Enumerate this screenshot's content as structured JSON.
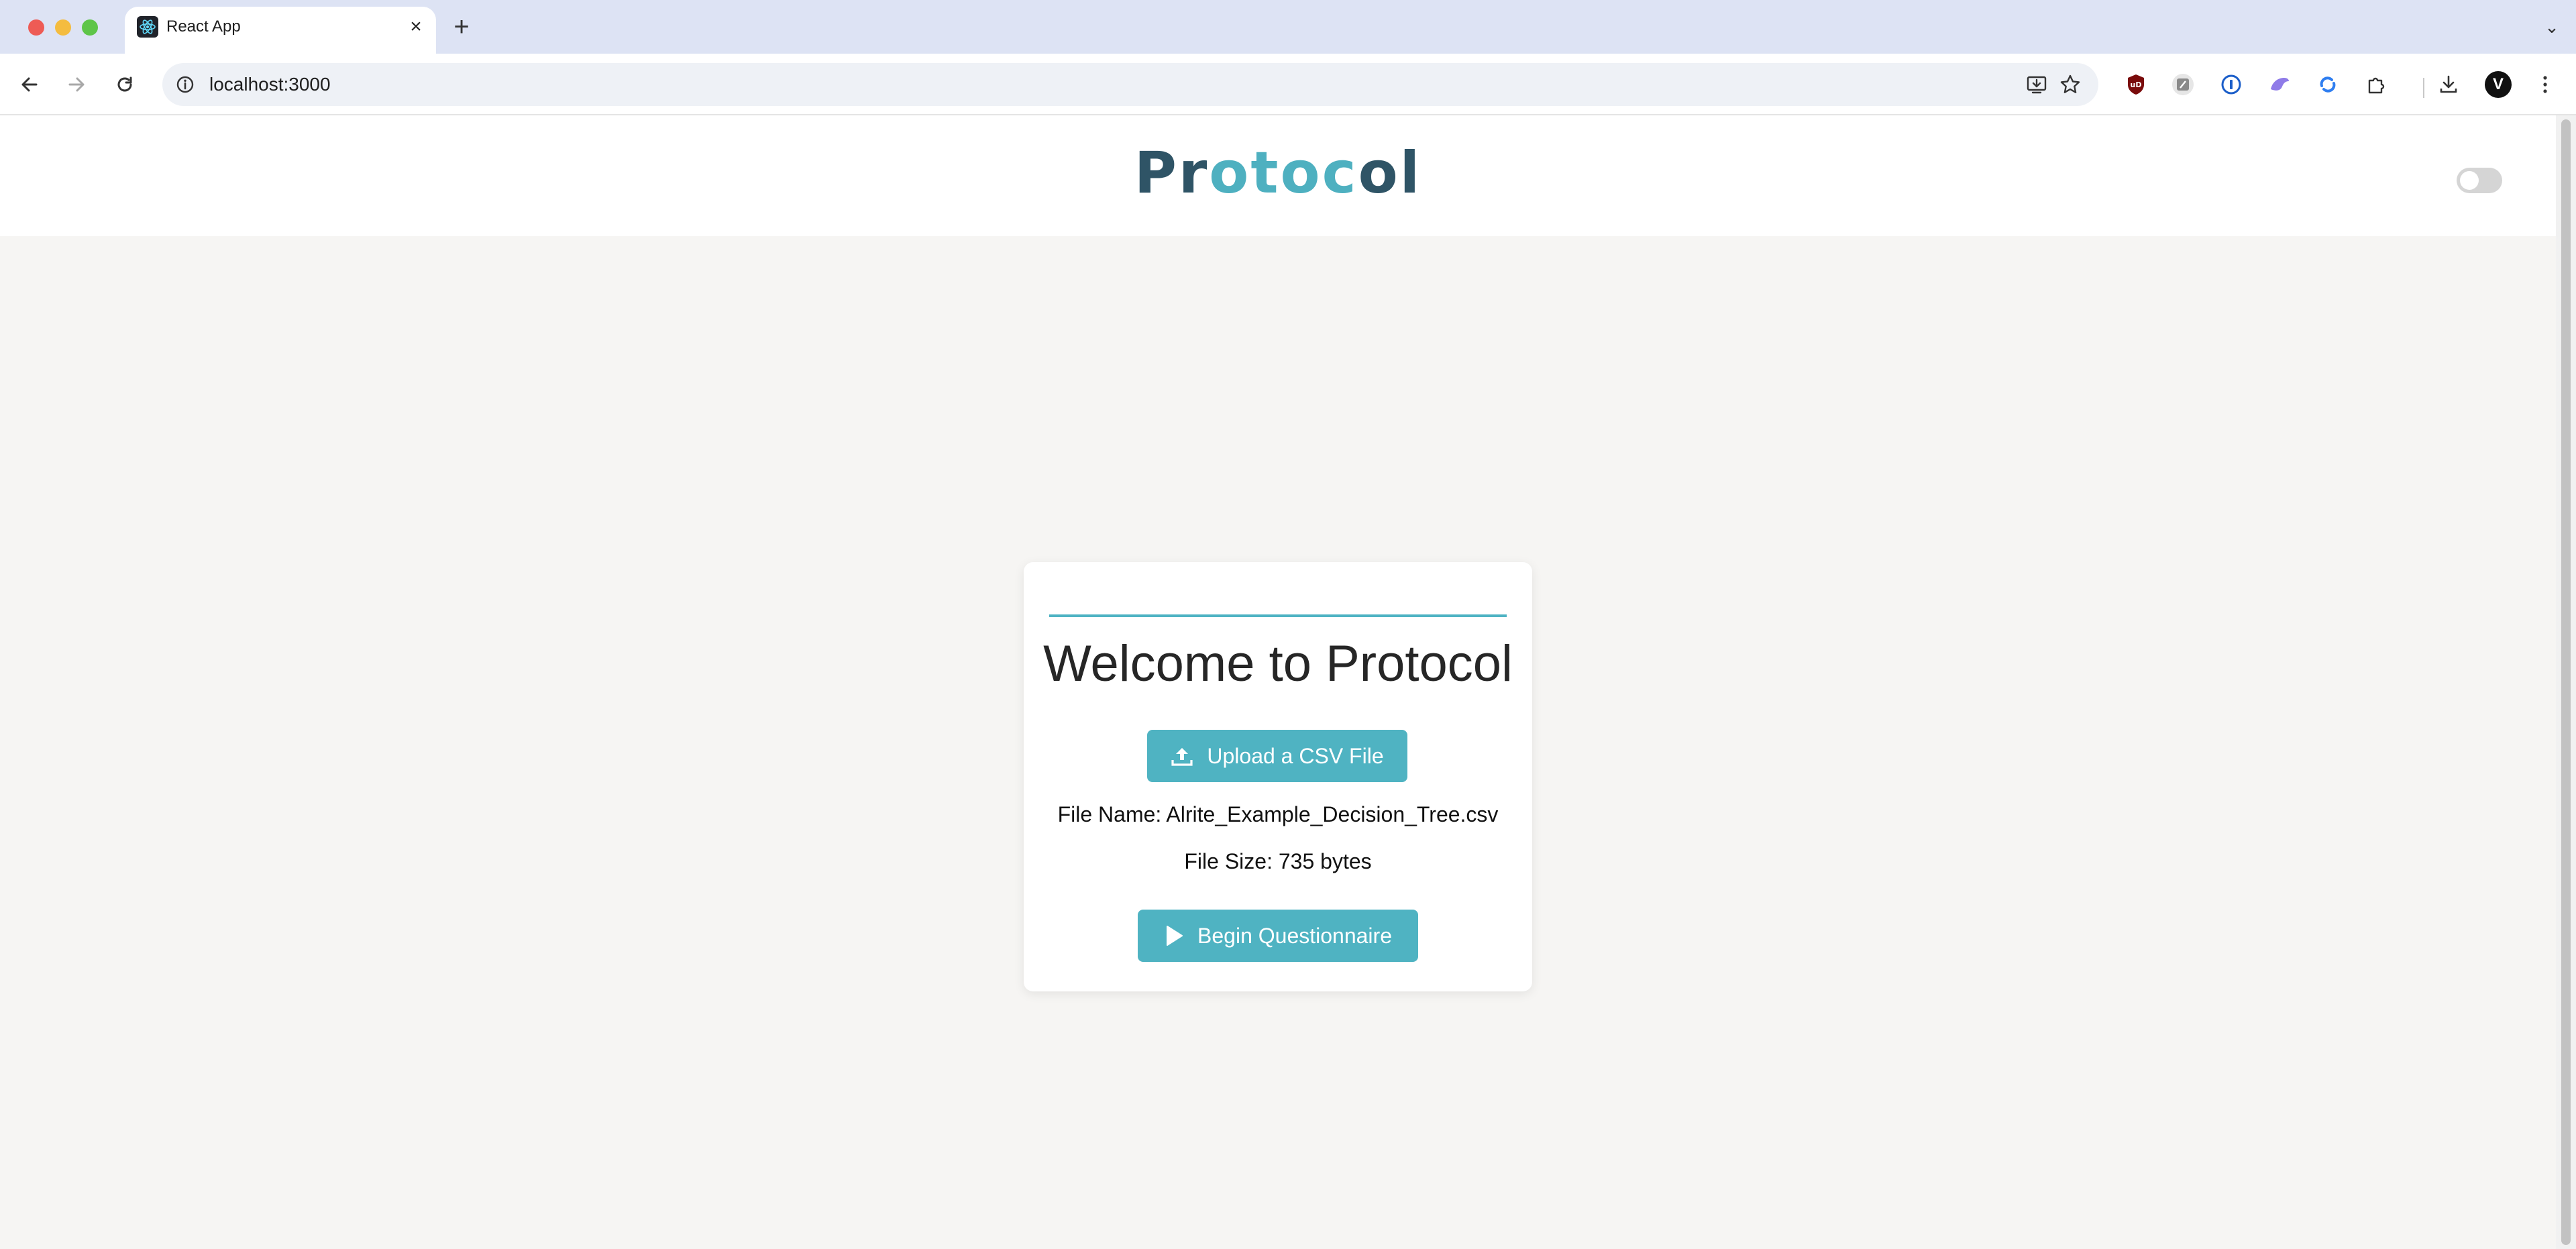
{
  "browser": {
    "tab_title": "React App",
    "url": "localhost:3000",
    "profile_initial": "V"
  },
  "app": {
    "logo_parts": [
      "P",
      "r",
      "o",
      "t",
      "o",
      "c",
      "o",
      "l"
    ],
    "logo_text": "Protocol",
    "theme_toggle_on": false
  },
  "card": {
    "title": "Welcome to Protocol",
    "upload_label": "Upload a CSV File",
    "file_name": "File Name: Alrite_Example_Decision_Tree.csv",
    "file_size": "File Size: 735 bytes",
    "begin_label": "Begin Questionnaire"
  },
  "colors": {
    "accent": "#4fb3c2",
    "logo_dark": "#2f5466",
    "logo_light": "#4eb0c0",
    "page_bg": "#f6f5f3"
  }
}
